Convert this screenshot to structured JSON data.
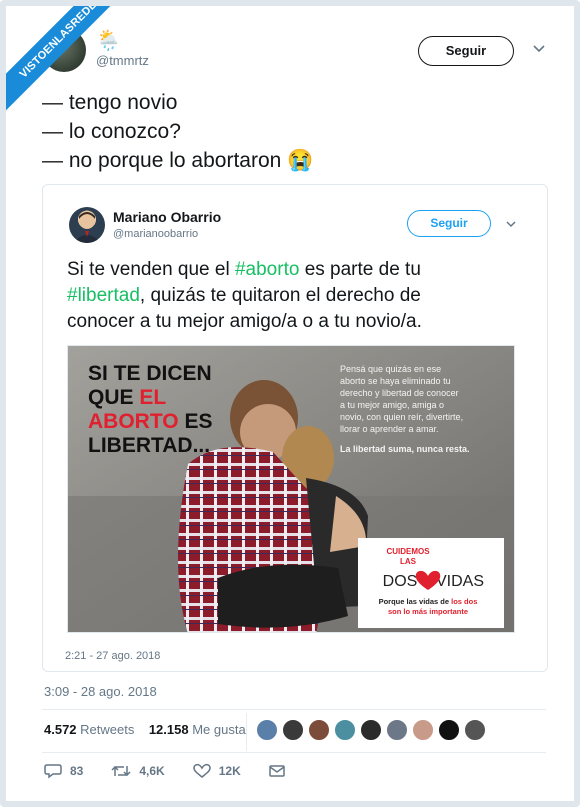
{
  "watermark": "VISTOENLASREDES",
  "tweet": {
    "handle": "@tmmrtz",
    "weather_icon": "cloud-rain-sun-icon",
    "follow_label": "Seguir",
    "lines": [
      "— tengo novio",
      "— lo conozco?",
      "— no porque lo abortaron 😭"
    ],
    "timestamp": "3:09 - 28 ago. 2018",
    "retweets_count": "4.572",
    "retweets_label": "Retweets",
    "likes_count": "12.158",
    "likes_label": "Me gusta",
    "actions": {
      "replies": "83",
      "retweets": "4,6K",
      "likes": "12K"
    }
  },
  "quoted": {
    "name": "Mariano Obarrio",
    "handle": "@marianoobarrio",
    "follow_label": "Seguir",
    "text": {
      "l1_pre": "Si te venden que el ",
      "l1_hash": "#aborto",
      "l1_post": " es parte de tu",
      "l2_hash": "#libertad",
      "l2_post": ", quizás te quitaron el derecho de",
      "l3": "conocer a tu mejor amigo/a o a tu novio/a."
    },
    "timestamp": "2:21 - 27 ago. 2018",
    "image": {
      "headline": [
        "SI TE DICEN",
        "QUE ",
        "EL",
        "ABORTO",
        " ES",
        "LIBERTAD..."
      ],
      "side_text": [
        "Pensá que quizás en ese",
        "aborto se haya eliminado tu",
        "derecho y libertad de conocer",
        "a tu mejor amigo, amiga o",
        "novio, con quien reír, divertirte,",
        "llorar o aprender a amar."
      ],
      "side_bold": "La libertad suma, nunca resta.",
      "badge_top": "CUIDEMOS",
      "badge_las": "LAS",
      "badge_dos": "DOS",
      "badge_vidas": "VIDAS",
      "badge_sub1_pre": "Porque las vidas de ",
      "badge_sub1_red": "los dos",
      "badge_sub2": "son lo más importante"
    }
  },
  "colors": {
    "accent": "#1da1f2",
    "hashtag": "#17bf63",
    "ribbon": "#1a8bd8",
    "red": "#e0202e"
  }
}
